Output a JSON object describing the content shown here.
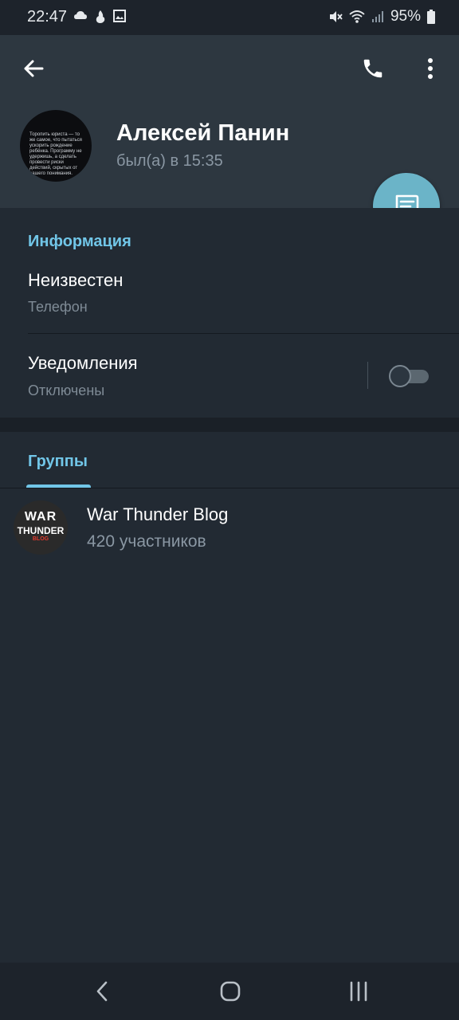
{
  "status_bar": {
    "time": "22:47",
    "battery": "95%",
    "icons_left": [
      "cloud-icon",
      "fire-icon",
      "image-icon"
    ],
    "icons_right": [
      "mute-icon",
      "wifi-icon",
      "signal-icon",
      "battery-icon"
    ]
  },
  "toolbar": {
    "back_icon": "arrow-left-icon",
    "call_icon": "phone-icon",
    "more_icon": "dots-vertical-icon"
  },
  "profile": {
    "name": "Алексей Панин",
    "last_seen": "был(а) в 15:35",
    "avatar_text": "Торопить юриста — то же самое, что пытаться ускорить рождение ребёнка. Программу не удержишь, а сделать провести риски действий, скрытых от вашего понимания."
  },
  "fab_icon": "message-icon",
  "info_section": {
    "title": "Информация",
    "phone_value": "Неизвестен",
    "phone_label": "Телефон",
    "notifications_title": "Уведомления",
    "notifications_state": "Отключены",
    "notifications_enabled": false
  },
  "groups": {
    "tab_label": "Группы",
    "items": [
      {
        "name": "War Thunder Blog",
        "members": "420 участников",
        "logo_war": "WAR",
        "logo_thunder": "THUNDER",
        "logo_blog": "BLOG"
      }
    ]
  },
  "nav_bar": {
    "back_icon": "chevron-left-icon",
    "home_icon": "home-icon",
    "recents_icon": "recents-icon"
  },
  "colors": {
    "accent": "#71c6e8",
    "fab": "#6bb4c8",
    "header_bg": "#2d3740",
    "body_bg": "#222a33",
    "secondary_text": "#8a97a3"
  }
}
